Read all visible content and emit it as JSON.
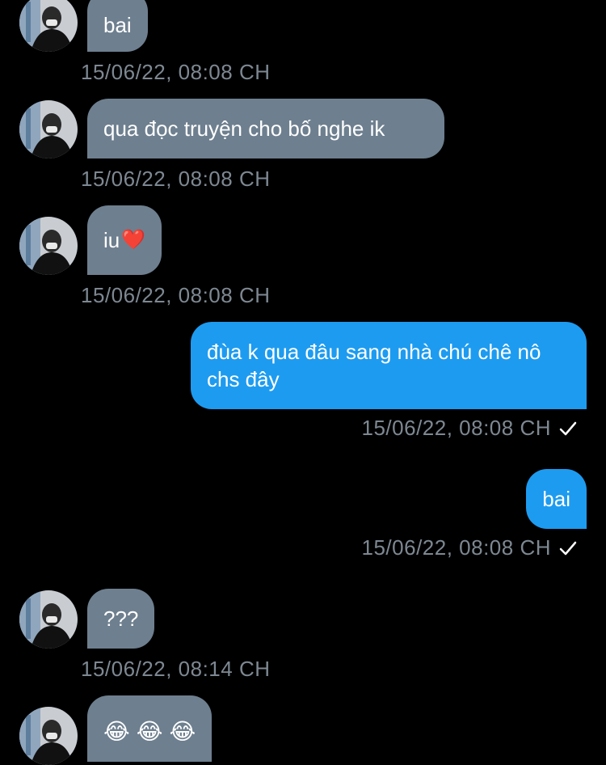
{
  "messages": [
    {
      "id": "m1",
      "dir": "in",
      "text": "bai",
      "time": "15/06/22, 08:08 CH"
    },
    {
      "id": "m2",
      "dir": "in",
      "text": "qua đọc truyện cho bố nghe ik",
      "time": "15/06/22, 08:08 CH"
    },
    {
      "id": "m3",
      "dir": "in",
      "text": "iu",
      "emoji": "❤️",
      "time": "15/06/22, 08:08 CH"
    },
    {
      "id": "m4",
      "dir": "out",
      "text": "đùa k qua đâu sang nhà chú chê nô chs đây",
      "time": "15/06/22, 08:08 CH",
      "status_icon": "check-icon"
    },
    {
      "id": "m5",
      "dir": "out",
      "text": "bai",
      "time": "15/06/22, 08:08 CH",
      "status_icon": "check-icon"
    },
    {
      "id": "m6",
      "dir": "in",
      "text": "???",
      "time": "15/06/22, 08:14 CH"
    },
    {
      "id": "m7",
      "dir": "in",
      "emojis": [
        "😂",
        "😂",
        "😂"
      ]
    }
  ],
  "colors": {
    "background": "#000000",
    "incoming_bubble": "#6e7f8f",
    "outgoing_bubble": "#1d9bf0",
    "timestamp": "#7e8892"
  },
  "icons": {
    "avatar": "avatar",
    "status": "check-icon"
  }
}
